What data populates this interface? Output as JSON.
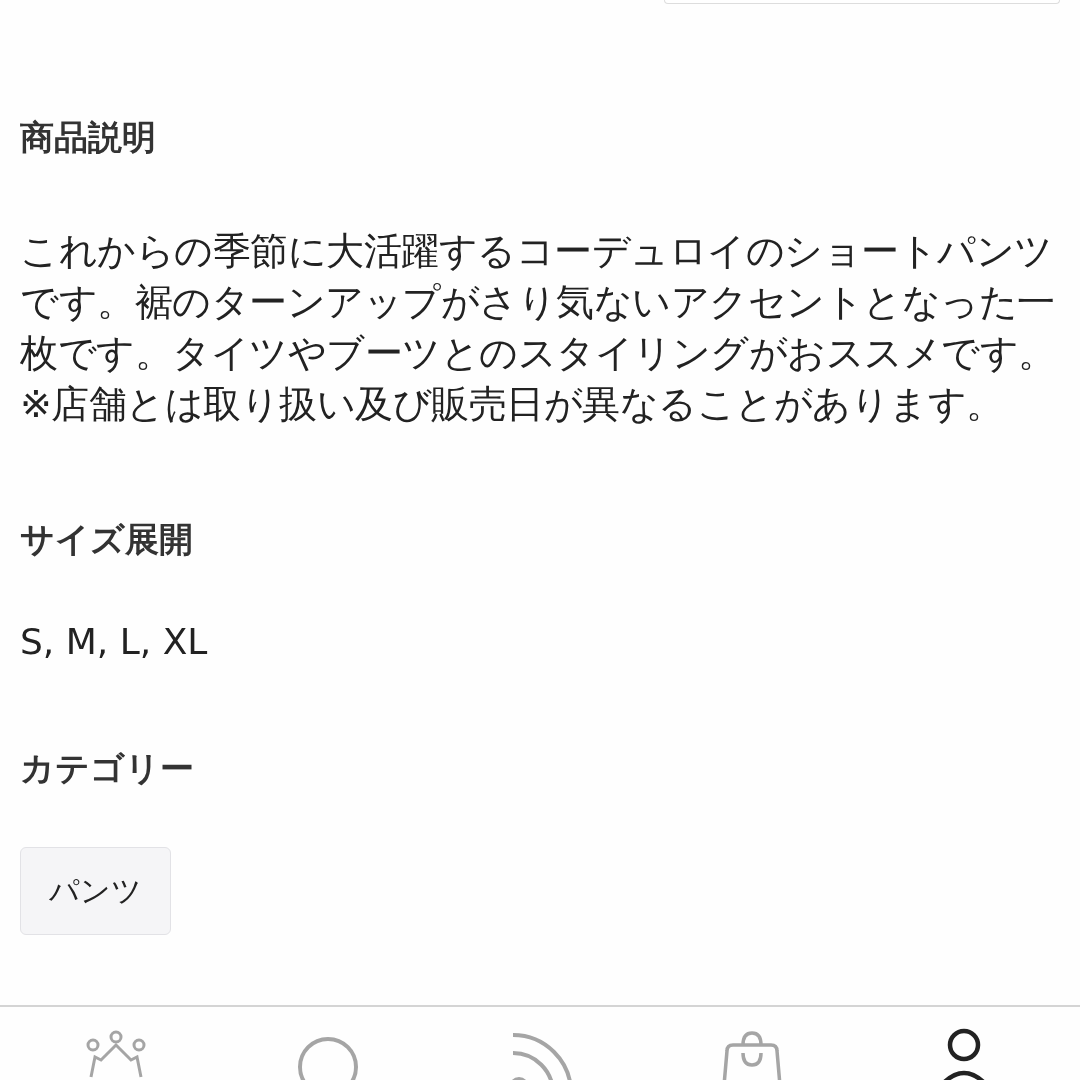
{
  "sections": [
    {
      "heading": "商品説明",
      "kind": "text",
      "text": "これからの季節に大活躍するコーデュロイのショートパンツです。裾のターンアップがさり気ないアクセントとなった一枚です。タイツやブーツとのスタイリングがおススメです。 ※店舗とは取り扱い及び販売日が異なることがあります。"
    },
    {
      "heading": "サイズ展開",
      "kind": "text",
      "text": "S, M, L, XL"
    },
    {
      "heading": "カテゴリー",
      "kind": "tags",
      "tags": [
        "パンツ"
      ]
    }
  ],
  "bottom_nav": [
    {
      "selected": false
    },
    {
      "selected": false
    },
    {
      "selected": false
    },
    {
      "selected": false
    },
    {
      "selected": true
    }
  ]
}
